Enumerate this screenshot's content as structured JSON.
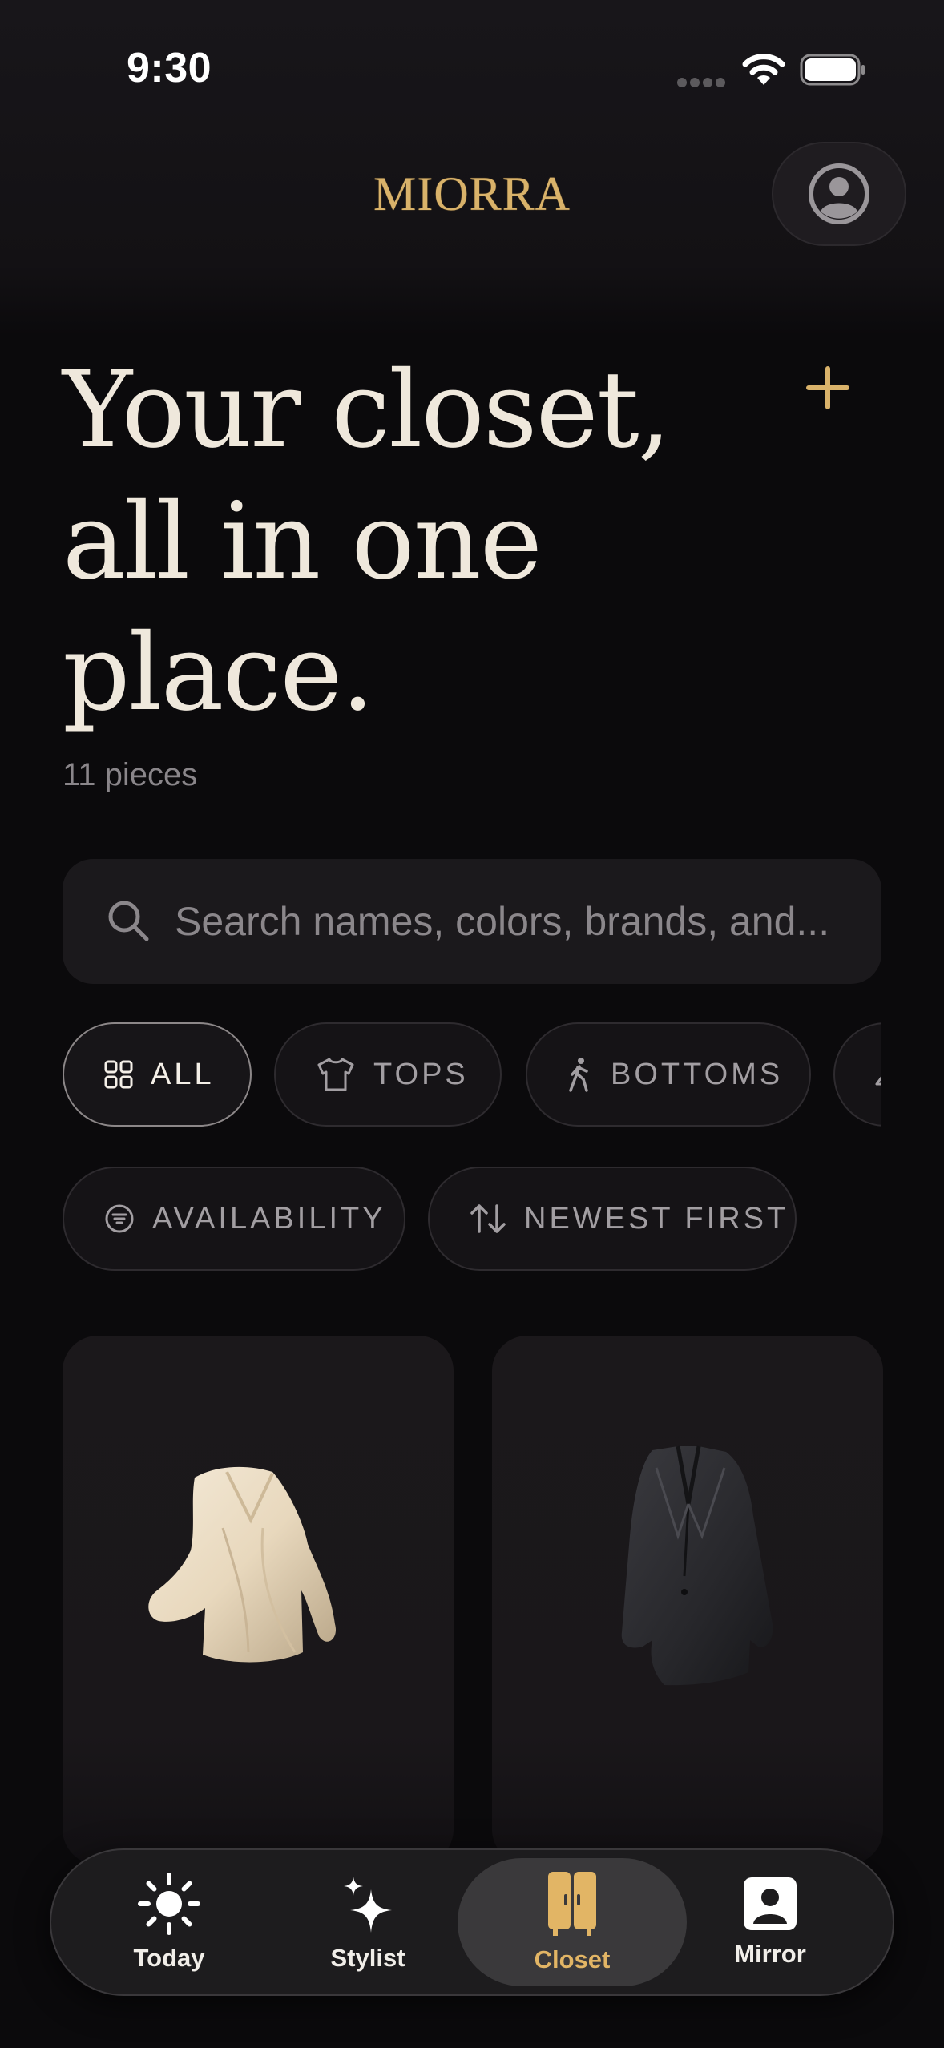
{
  "status_bar": {
    "time": "9:30"
  },
  "header": {
    "brand": "MIORRA",
    "profile_icon": "person-circle-icon"
  },
  "hero": {
    "title_line_1": "Your closet,",
    "title_line_2": "all in one",
    "title_line_3": "place.",
    "count": "11 pieces"
  },
  "search": {
    "placeholder": "Search names, colors, brands, and..."
  },
  "filters": {
    "categories": [
      {
        "label": "ALL",
        "icon": "grid-icon",
        "active": true
      },
      {
        "label": "TOPS",
        "icon": "tshirt-icon",
        "active": false
      },
      {
        "label": "BOTTOMS",
        "icon": "walking-person-icon",
        "active": false
      }
    ],
    "options": [
      {
        "label": "AVAILABILITY",
        "icon": "filter-lines-icon"
      },
      {
        "label": "NEWEST FIRST",
        "icon": "sort-arrows-icon"
      }
    ]
  },
  "items": [
    {
      "name": "cream silk blouse",
      "color": "#efe3cf"
    },
    {
      "name": "charcoal blazer",
      "color": "#2a2a2e"
    }
  ],
  "tabs": [
    {
      "label": "Today",
      "icon": "sun-icon",
      "active": false
    },
    {
      "label": "Stylist",
      "icon": "sparkles-icon",
      "active": false
    },
    {
      "label": "Closet",
      "icon": "wardrobe-icon",
      "active": true
    },
    {
      "label": "Mirror",
      "icon": "person-frame-icon",
      "active": false
    }
  ],
  "colors": {
    "accent": "#d9b26a",
    "background": "#0b0a0c",
    "surface": "#1b191c"
  }
}
